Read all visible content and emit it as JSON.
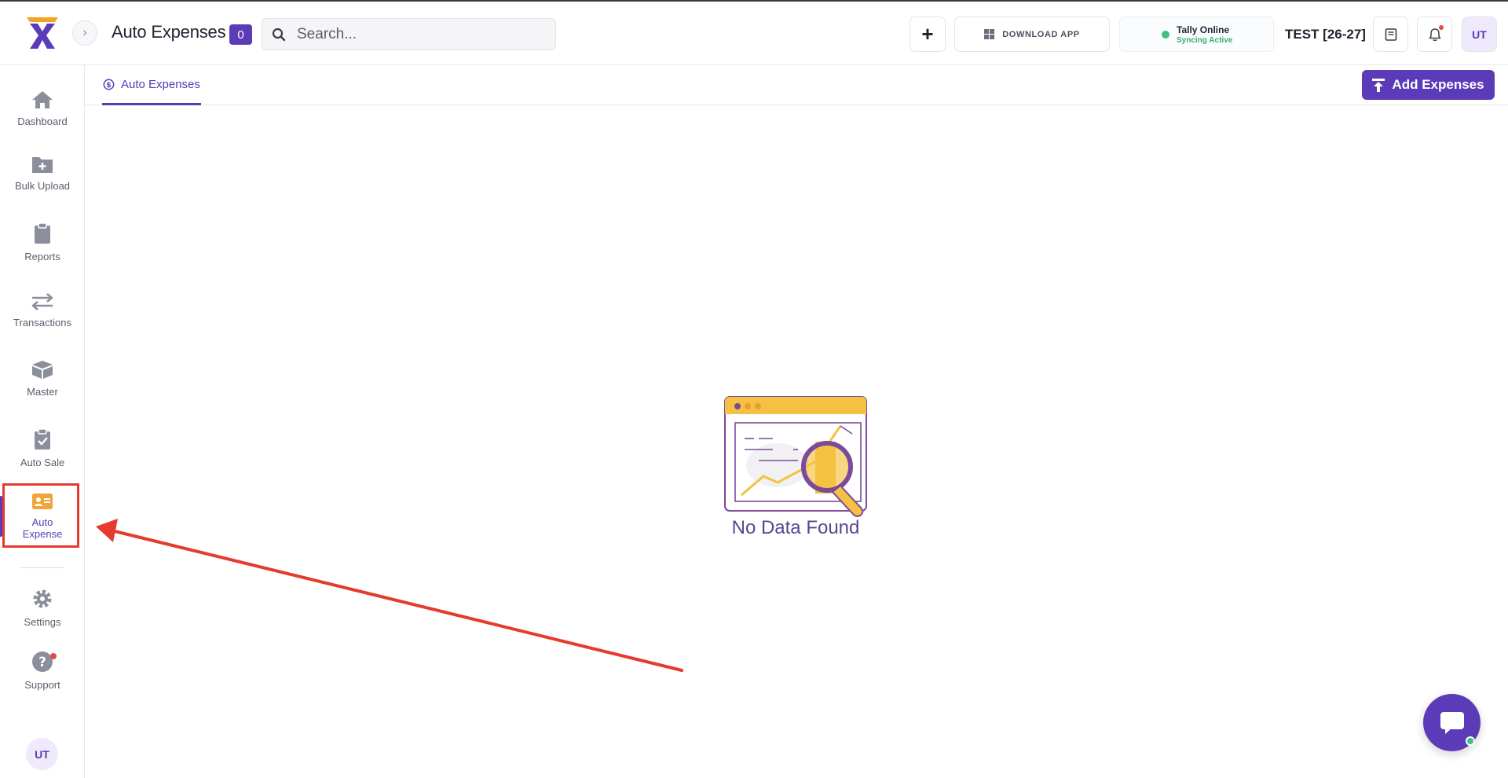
{
  "header": {
    "title": "Auto Expenses",
    "count": "0",
    "search_placeholder": "Search...",
    "plus_label": "+",
    "download_label": "DOWNLOAD APP",
    "tally_title": "Tally Online",
    "tally_status": "Syncing Active",
    "company": "TEST [26-27]",
    "user_initials": "UT"
  },
  "sidebar": {
    "items": [
      {
        "label": "Dashboard",
        "icon": "home-icon"
      },
      {
        "label": "Bulk Upload",
        "icon": "folder-plus-icon"
      },
      {
        "label": "Reports",
        "icon": "clipboard-icon"
      },
      {
        "label": "Transactions",
        "icon": "swap-arrows-icon"
      },
      {
        "label": "Master",
        "icon": "box-icon"
      },
      {
        "label": "Auto Sale",
        "icon": "clipboard-check-icon"
      },
      {
        "label": "Auto Expense",
        "icon": "id-card-icon",
        "active": true
      },
      {
        "label": "Settings",
        "icon": "gear-icon"
      },
      {
        "label": "Support",
        "icon": "question-icon"
      }
    ],
    "user_initials": "UT"
  },
  "tabs": [
    {
      "label": "Auto Expenses",
      "active": true
    }
  ],
  "actions": {
    "add_expenses": "Add Expenses"
  },
  "empty_state": {
    "message": "No Data Found"
  },
  "colors": {
    "brand": "#5b3bb8",
    "annotation": "#e63a2e",
    "online": "#3fbf7f",
    "illustration_accent": "#f4c141"
  }
}
